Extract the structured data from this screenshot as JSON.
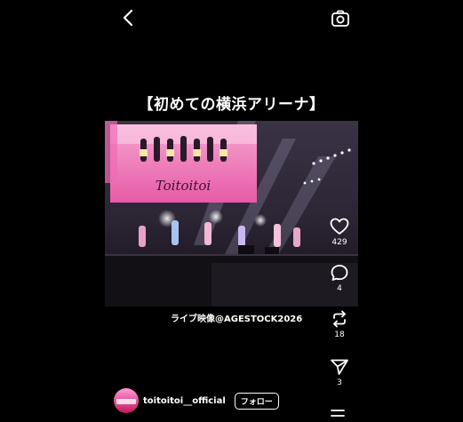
{
  "header": {
    "back_icon": "chevron-left-icon",
    "camera_icon": "camera-icon"
  },
  "post": {
    "title": "【初めての横浜アリーナ】",
    "caption": "ライブ映像@AGESTOCK2026",
    "screen_logo": "Toitoitoi"
  },
  "actions": {
    "like_count": "429",
    "comment_count": "4",
    "repost_count": "18",
    "share_count": "3"
  },
  "account": {
    "username": "toitoitoi__official",
    "follow_label": "フォロー"
  },
  "colors": {
    "background": "#000000",
    "text": "#ffffff",
    "screen_pink": "#f06bb4"
  }
}
